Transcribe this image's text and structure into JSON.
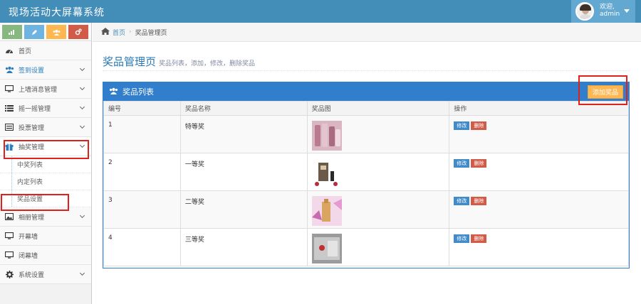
{
  "app": {
    "title": "现场活动大屏幕系统",
    "welcome_line1": "欢迎,",
    "welcome_user": "admin"
  },
  "shortcuts": [
    {
      "icon": "signal-icon",
      "color": "#87b87f"
    },
    {
      "icon": "pencil-icon",
      "color": "#6fb3e0"
    },
    {
      "icon": "users-icon",
      "color": "#ffb752"
    },
    {
      "icon": "cogs-icon",
      "color": "#d15b47"
    }
  ],
  "sidebar": {
    "items": [
      {
        "label": "首页",
        "icon": "dashboard-icon"
      },
      {
        "label": "签到设置",
        "icon": "users-icon"
      },
      {
        "label": "上墙消息管理",
        "icon": "desktop-icon"
      },
      {
        "label": "摇一摇管理",
        "icon": "list-icon"
      },
      {
        "label": "投票管理",
        "icon": "list-alt-icon"
      },
      {
        "label": "抽奖管理",
        "icon": "gift-icon"
      },
      {
        "label": "相册管理",
        "icon": "picture-icon"
      },
      {
        "label": "开幕墙",
        "icon": "desktop-icon"
      },
      {
        "label": "闭幕墙",
        "icon": "desktop-icon"
      },
      {
        "label": "系统设置",
        "icon": "cog-icon"
      }
    ],
    "sub_items": [
      {
        "label": "中奖列表"
      },
      {
        "label": "内定列表"
      },
      {
        "label": "奖品设置"
      }
    ]
  },
  "breadcrumb": {
    "home": "首页",
    "current": "奖品管理页"
  },
  "page": {
    "title": "奖品管理页",
    "subtitle": "奖品列表，添加，修改，删除奖品"
  },
  "widget": {
    "title": "奖品列表",
    "add_button": "添加奖品"
  },
  "table": {
    "headers": [
      "编号",
      "奖品名称",
      "奖品图",
      "操作"
    ],
    "edit_label": "修改",
    "delete_label": "删除",
    "rows": [
      {
        "id": "1",
        "name": "特等奖"
      },
      {
        "id": "2",
        "name": "一等奖"
      },
      {
        "id": "3",
        "name": "二等奖"
      },
      {
        "id": "4",
        "name": "三等奖"
      }
    ]
  }
}
